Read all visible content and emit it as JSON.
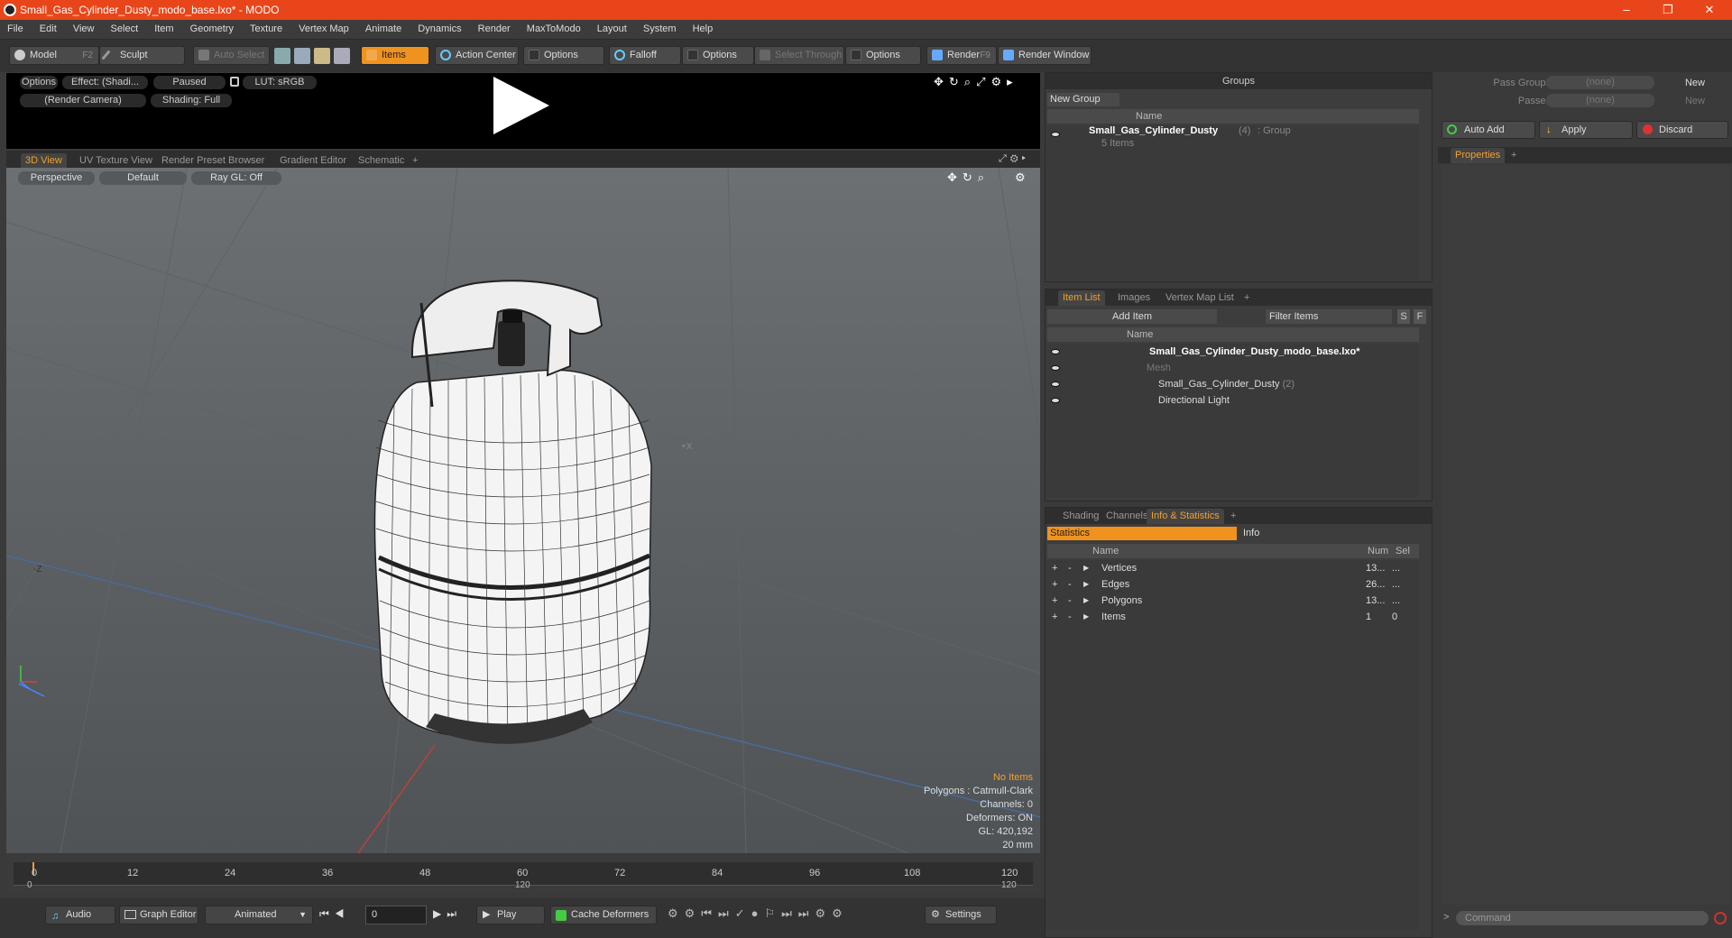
{
  "window": {
    "title": "Small_Gas_Cylinder_Dusty_modo_base.lxo* - MODO",
    "minimize": "–",
    "maximize": "❐",
    "close": "✕"
  },
  "menu": [
    "File",
    "Edit",
    "View",
    "Select",
    "Item",
    "Geometry",
    "Texture",
    "Vertex Map",
    "Animate",
    "Dynamics",
    "Render",
    "MaxToModo",
    "Layout",
    "System",
    "Help"
  ],
  "toolbar": {
    "model": "Model",
    "model_key": "F2",
    "sculpt": "Sculpt",
    "auto_select": "Auto Select",
    "items": "Items",
    "action_center": "Action Center",
    "options1": "Options",
    "falloff": "Falloff",
    "options2": "Options",
    "select_through": "Select Through",
    "options3": "Options",
    "render": "Render",
    "render_key": "F9",
    "render_window": "Render Window"
  },
  "preview": {
    "options": "Options",
    "effect": "Effect: (Shadi...",
    "paused": "Paused",
    "lut": "LUT: sRGB",
    "camera": "(Render Camera)",
    "shading": "Shading: Full"
  },
  "view_tabs": [
    "3D View",
    "UV Texture View",
    "Render Preset Browser",
    "Gradient Editor",
    "Schematic",
    "+"
  ],
  "viewport": {
    "perspective": "Perspective",
    "default": "Default",
    "raygl": "Ray GL: Off",
    "axis_z": "-Z",
    "axis_x": "+X",
    "stats": {
      "no_items": "No Items",
      "polygons": "Polygons : Catmull-Clark",
      "channels": "Channels: 0",
      "deformers": "Deformers: ON",
      "gl": "GL: 420,192",
      "scale": "20 mm"
    }
  },
  "timeline": {
    "ticks": [
      "0",
      "12",
      "24",
      "36",
      "48",
      "60",
      "72",
      "84",
      "96",
      "108",
      "120"
    ],
    "sub_left": "0",
    "sub_mid": "120",
    "sub_right": "120"
  },
  "transport": {
    "audio": "Audio",
    "graph_editor": "Graph Editor",
    "animated": "Animated",
    "frame": "0",
    "play": "Play",
    "cache": "Cache Deformers",
    "settings": "Settings"
  },
  "groups": {
    "title": "Groups",
    "new_group": "New Group",
    "col_name": "Name",
    "item_name": "Small_Gas_Cylinder_Dusty",
    "item_count": "(4)",
    "item_type": ": Group",
    "item_sub": "5 Items"
  },
  "item_list": {
    "tabs": [
      "Item List",
      "Images",
      "Vertex Map List",
      "+"
    ],
    "add_item": "Add Item",
    "filter": "Filter Items",
    "s": "S",
    "f": "F",
    "col_name": "Name",
    "rows": [
      {
        "label": "Small_Gas_Cylinder_Dusty_modo_base.lxo*"
      },
      {
        "label": "Mesh"
      },
      {
        "label": "Small_Gas_Cylinder_Dusty",
        "extra": "(2)"
      },
      {
        "label": "Directional Light"
      }
    ]
  },
  "stats_panel": {
    "tabs": [
      "Shading",
      "Channels",
      "Info & Statistics",
      "+"
    ],
    "sub_tabs": [
      "Statistics",
      "Info"
    ],
    "col_name": "Name",
    "col_num": "Num",
    "col_sel": "Sel",
    "rows": [
      {
        "name": "Vertices",
        "num": "13...",
        "sel": "..."
      },
      {
        "name": "Edges",
        "num": "26...",
        "sel": "..."
      },
      {
        "name": "Polygons",
        "num": "13...",
        "sel": "..."
      },
      {
        "name": "Items",
        "num": "1",
        "sel": "0"
      }
    ]
  },
  "right": {
    "pass_groups": "Pass Groups",
    "passes": "Passes",
    "none1": "(none)",
    "none2": "(none)",
    "new1": "New",
    "new2": "New",
    "auto_add": "Auto Add",
    "apply": "Apply",
    "discard": "Discard",
    "properties": "Properties",
    "plus": "+",
    "command": "Command"
  }
}
